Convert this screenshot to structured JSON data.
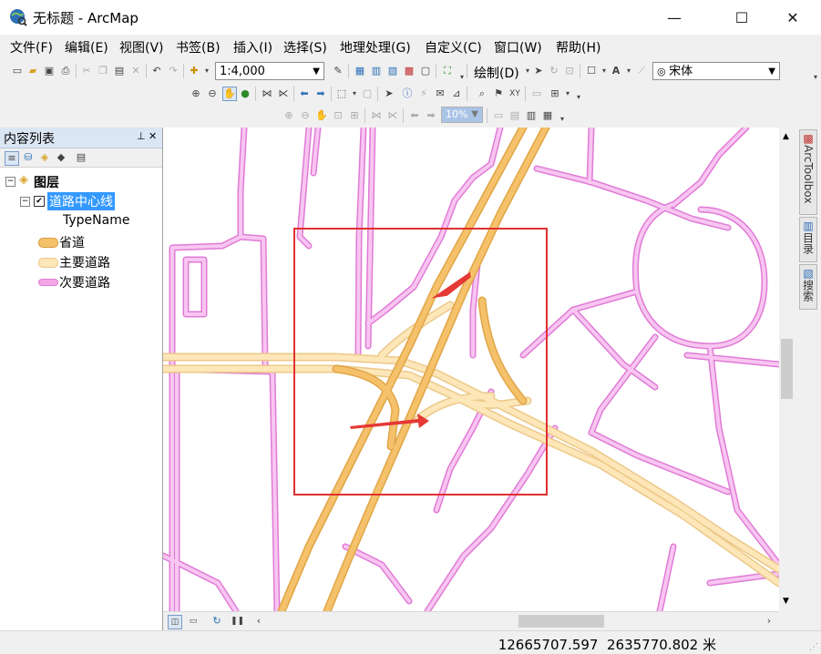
{
  "window": {
    "title": "无标题 - ArcMap",
    "minimize": "—",
    "maximize": "☐",
    "close": "✕"
  },
  "menu": [
    "文件(F)",
    "编辑(E)",
    "视图(V)",
    "书签(B)",
    "插入(I)",
    "选择(S)",
    "地理处理(G)",
    "自定义(C)",
    "窗口(W)",
    "帮助(H)"
  ],
  "toolbar": {
    "scale": "1:4,000",
    "draw_label": "绘制(D)",
    "font_name": "宋体",
    "zoom_percent": "10%"
  },
  "toc": {
    "title": "内容列表",
    "pin": "⊥",
    "close": "✕",
    "root_label": "图层",
    "layer_label": "道路中心线",
    "field_label": "TypeName",
    "legend": [
      {
        "label": "省道",
        "color": "#f5c26b",
        "border": "#d99a3a"
      },
      {
        "label": "主要道路",
        "color": "#fde6b8",
        "border": "#e8c98a"
      },
      {
        "label": "次要道路",
        "color": "#f4a6ea",
        "border": "#e07bd6"
      }
    ]
  },
  "dock": {
    "arctoolbox": "ArcToolbox",
    "catalog": "目录",
    "search": "搜索"
  },
  "status": {
    "x": "12665707.597",
    "y": "2635770.802",
    "unit": "米"
  },
  "colors": {
    "major_road": "#fde6b8",
    "provincial_road": "#f5c26b",
    "secondary_road": "#f4a6ea",
    "highlight_box": "#e03030"
  }
}
